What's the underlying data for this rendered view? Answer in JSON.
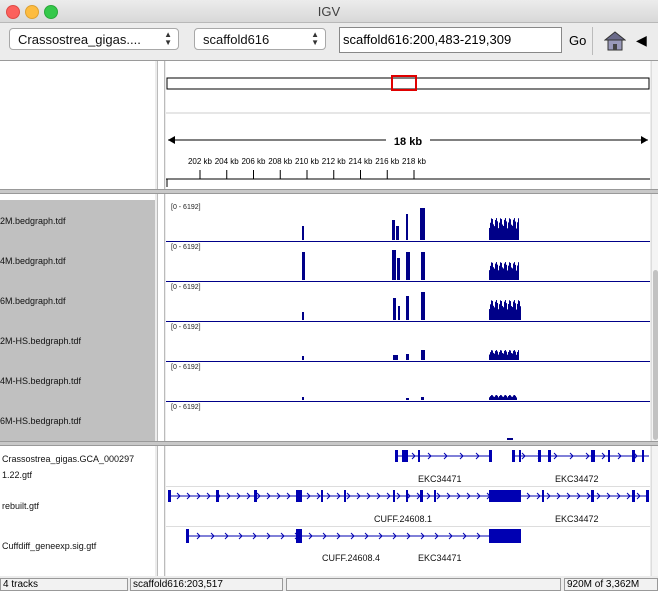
{
  "window": {
    "title": "IGV"
  },
  "toolbar": {
    "genome": "Crassostrea_gigas....",
    "chromosome": "scaffold616",
    "locus": "scaffold616:200,483-219,309",
    "go_label": "Go"
  },
  "ruler": {
    "span_label": "18 kb",
    "ticks": [
      "202 kb",
      "204 kb",
      "206 kb",
      "208 kb",
      "210 kb",
      "212 kb",
      "214 kb",
      "216 kb",
      "218 kb"
    ]
  },
  "data_tracks": [
    {
      "name": "2M.bedgraph.tdf",
      "range": "[0 - 6192]"
    },
    {
      "name": "4M.bedgraph.tdf",
      "range": "[0 - 6192]"
    },
    {
      "name": "6M.bedgraph.tdf",
      "range": "[0 - 6192]"
    },
    {
      "name": "2M-HS.bedgraph.tdf",
      "range": "[0 - 6192]"
    },
    {
      "name": "4M-HS.bedgraph.tdf",
      "range": "[0 - 6192]"
    },
    {
      "name": "6M-HS.bedgraph.tdf",
      "range": "[0 - 6192]"
    }
  ],
  "feature_tracks": [
    {
      "name_line1": "Crassostrea_gigas.GCA_000297",
      "name_line2": "1.22.gtf",
      "labels": [
        "EKC34471",
        "EKC34472"
      ]
    },
    {
      "name": "rebuilt.gtf",
      "labels": [
        "CUFF.24608.1",
        "EKC34472"
      ]
    },
    {
      "name": "Cuffdiff_geneexp.sig.gtf",
      "labels": [
        "CUFF.24608.4",
        "EKC34471"
      ]
    }
  ],
  "status": {
    "tracks": "4 tracks",
    "position": "scaffold616:203,517",
    "memory": "920M of 3,362M"
  },
  "colors": {
    "feature": "#0000b2",
    "coverage": "#000088",
    "selection": "#e00000"
  }
}
